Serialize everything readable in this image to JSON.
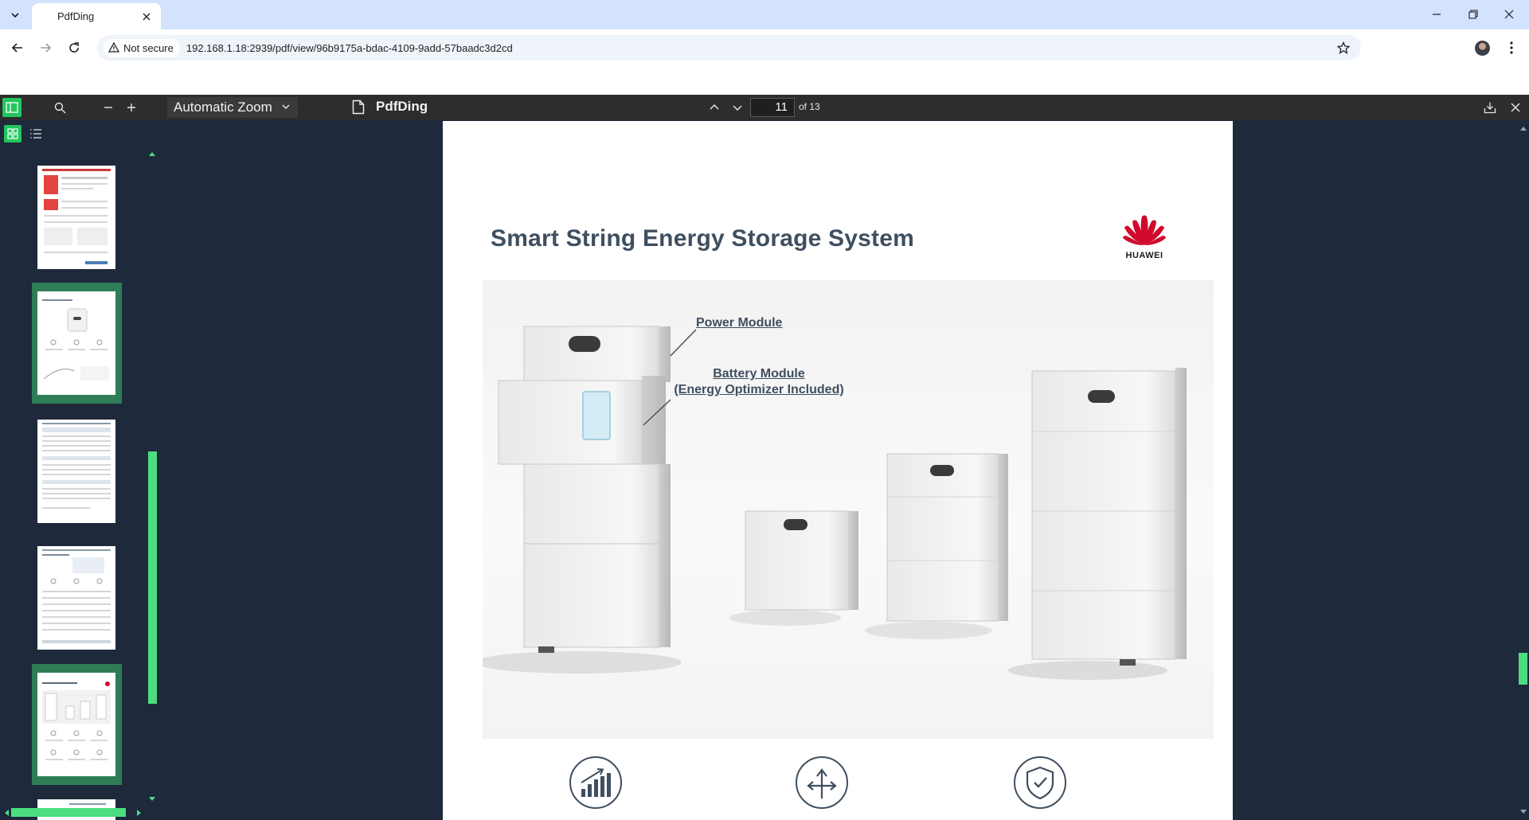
{
  "browser": {
    "tab_title": "PdfDing",
    "not_secure_label": "Not secure",
    "url": "192.168.1.18:2939/pdf/view/96b9175a-bdac-4109-9add-57baadc3d2cd"
  },
  "pdf_toolbar": {
    "zoom_value": "Automatic Zoom",
    "doc_title": "PdfDing",
    "page_number": "11",
    "page_count": "of 13"
  },
  "sidebar": {
    "thumbnail_count_visible": 6,
    "selected_thumbnails": [
      2,
      5
    ]
  },
  "page": {
    "title": "Smart String Energy Storage System",
    "logo_text": "HUAWEI",
    "callout_power": "Power Module",
    "callout_battery_line1": "Battery Module",
    "callout_battery_line2": "(Energy Optimizer Included)"
  },
  "colors": {
    "accent": "#22c55e",
    "viewer_bg": "#1e293b",
    "toolbar_bg": "#2d2d2d",
    "title_text": "#3f4f5f",
    "huawei_red": "#cf0a2c"
  },
  "icons": [
    "chevron-down-icon",
    "close-icon",
    "minimize-icon",
    "restore-icon",
    "back-icon",
    "forward-icon",
    "reload-icon",
    "warning-icon",
    "star-icon",
    "kebab-menu-icon",
    "sidebar-toggle-icon",
    "search-icon",
    "zoom-out-icon",
    "zoom-in-icon",
    "document-icon",
    "chevron-up-icon",
    "download-icon",
    "thumbnails-icon",
    "outline-icon",
    "growth-chart-icon",
    "split-arrows-icon",
    "shield-check-icon"
  ]
}
